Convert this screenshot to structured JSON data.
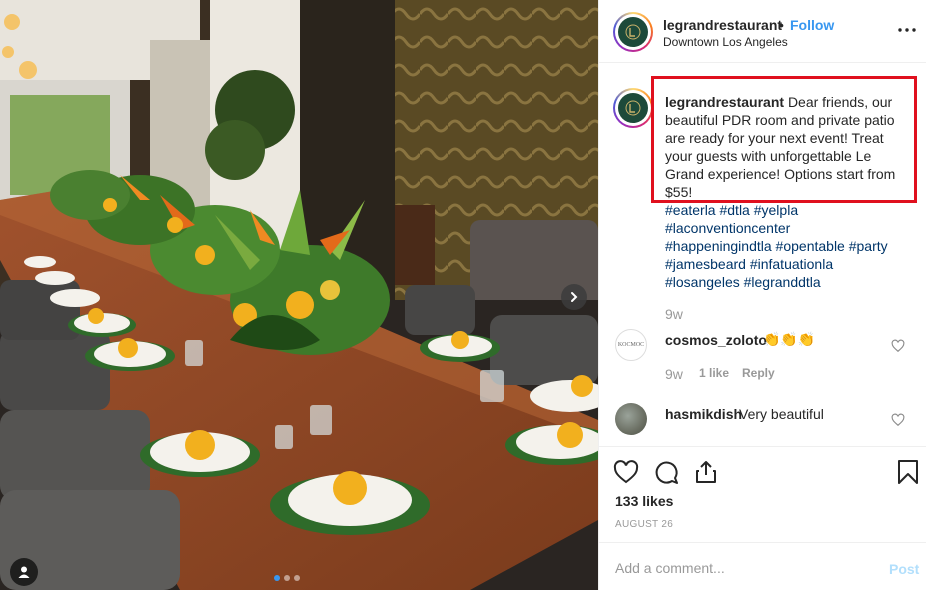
{
  "post": {
    "username": "legrandrestaurant",
    "separator": "•",
    "follow_label": "Follow",
    "location": "Downtown Los Angeles",
    "caption_text": "Dear friends, our beautiful PDR room and private patio are ready for your next event! Treat your guests with unforgettable Le Grand experience! Options start from $55!",
    "hashtags": [
      "#eaterla",
      "#dtla",
      "#yelpla",
      "#laconventioncenter",
      "#happeningindtla",
      "#opentable",
      "#party",
      "#jamesbeard",
      "#infatuationla",
      "#losangeles",
      "#legranddtla"
    ],
    "caption_time": "9w"
  },
  "comments": [
    {
      "username": "cosmos_zoloto",
      "text": "👏👏👏",
      "time": "9w",
      "likes": "1 like",
      "reply": "Reply",
      "avatar_text": "KOCMOC"
    },
    {
      "username": "hasmikdish",
      "text": "Very beautiful"
    }
  ],
  "actions": {
    "likes": "133 likes",
    "date": "AUGUST 26"
  },
  "add_comment": {
    "placeholder": "Add a comment...",
    "post_label": "Post"
  },
  "photo": {
    "carousel_dots": 3,
    "active_dot": 0
  },
  "colors": {
    "follow": "#3897f0",
    "highlight_box": "#e0101e",
    "hashtag": "#003569",
    "post_disabled": "#b2dffc"
  },
  "icons": [
    "more-options-icon",
    "heart-icon",
    "comment-icon",
    "share-icon",
    "bookmark-icon",
    "chevron-right-icon",
    "user-tag-icon"
  ]
}
